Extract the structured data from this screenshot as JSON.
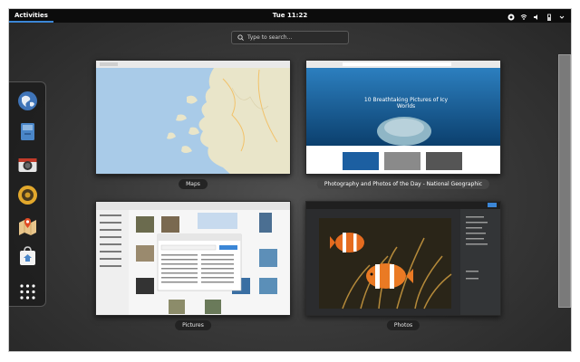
{
  "topbar": {
    "activities_label": "Activities",
    "clock": "Tue 11:22"
  },
  "search": {
    "placeholder": "Type to search..."
  },
  "dash": {
    "items": [
      "web-browser",
      "files",
      "camera",
      "music",
      "maps",
      "software"
    ],
    "show_apps_icon": "grid-icon"
  },
  "windows": [
    {
      "caption": "Maps"
    },
    {
      "caption": "Photography and Photos of the Day - National Geographic",
      "hero_text": "10 Breathtaking Pictures of Icy Worlds"
    },
    {
      "caption": "Pictures"
    },
    {
      "caption": "Photos"
    }
  ],
  "colors": {
    "accent": "#3b86d6",
    "topbar": "#0c0c0c",
    "map_water": "#a9cbe8",
    "ice_blue": "#3f8fc7"
  }
}
